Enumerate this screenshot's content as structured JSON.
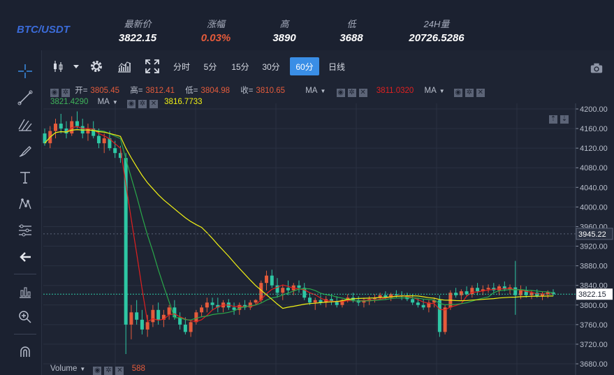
{
  "ticker": {
    "pair": "BTC/USDT",
    "stats": [
      {
        "label": "最新价",
        "value": "3822.15",
        "tone": "normal"
      },
      {
        "label": "涨幅",
        "value": "0.03%",
        "tone": "up"
      },
      {
        "label": "高",
        "value": "3890",
        "tone": "normal"
      },
      {
        "label": "低",
        "value": "3688",
        "tone": "normal"
      },
      {
        "label": "24H量",
        "value": "20726.5286",
        "tone": "normal"
      }
    ]
  },
  "toolbar": {
    "intervals": [
      "分时",
      "5分",
      "15分",
      "30分",
      "60分",
      "日线"
    ],
    "active_interval": "60分"
  },
  "left_tools": [
    "crosshair-icon",
    "trend-line-icon",
    "fib-icon",
    "brush-icon",
    "text-icon",
    "pattern-icon",
    "measure-icon",
    "back-arrow-icon",
    "indicator-icon",
    "zoom-icon",
    "magnet-icon"
  ],
  "legend": {
    "ohlc": {
      "open_label": "开=",
      "open": "3805.45",
      "high_label": "高=",
      "high": "3812.41",
      "low_label": "低=",
      "low": "3804.98",
      "close_label": "收=",
      "close": "3810.65"
    },
    "ma_label": "MA",
    "ma_red_value": "3811.0320",
    "ma_label_2": "MA",
    "ma_green_value": "3821.4290",
    "ma_label_3": "MA",
    "ma_yellow_value": "3816.7733",
    "volume_label": "Volume",
    "volume_value": "588"
  },
  "colors": {
    "up": "#e55b3b",
    "down": "#2ec7a4",
    "ma_red": "#e02020",
    "ma_green": "#2aa84a",
    "ma_yellow": "#f2f214",
    "bg": "#1e2433",
    "grid": "#2a3142",
    "last_price": "#2ec7a4"
  },
  "chart_data": {
    "type": "candlestick",
    "y_ticks": [
      4200,
      4160,
      4120,
      4080,
      4040,
      4000,
      3960,
      3920,
      3880,
      3840,
      3800,
      3760,
      3720,
      3680
    ],
    "y_tick_labels": [
      "4200.00",
      "4160.00",
      "4120.00",
      "4080.00",
      "4040.00",
      "4000.00",
      "3960.00",
      "3920.00",
      "3880.00",
      "3840.00",
      "3800.00",
      "3760.00",
      "3720.00",
      "3680.00"
    ],
    "ylim": [
      3670,
      4215
    ],
    "last_price": "3822.15",
    "crosshair_price": "3945.22",
    "candles": [
      [
        4150,
        4160,
        4125,
        4130
      ],
      [
        4130,
        4165,
        4120,
        4155
      ],
      [
        4155,
        4180,
        4140,
        4170
      ],
      [
        4170,
        4190,
        4150,
        4160
      ],
      [
        4160,
        4175,
        4140,
        4150
      ],
      [
        4150,
        4185,
        4145,
        4175
      ],
      [
        4175,
        4195,
        4160,
        4165
      ],
      [
        4165,
        4180,
        4140,
        4150
      ],
      [
        4150,
        4170,
        4135,
        4160
      ],
      [
        4160,
        4175,
        4140,
        4145
      ],
      [
        4145,
        4160,
        4120,
        4130
      ],
      [
        4130,
        4150,
        4110,
        4140
      ],
      [
        4140,
        4155,
        4115,
        4120
      ],
      [
        4120,
        4135,
        4100,
        4110
      ],
      [
        4110,
        4125,
        4090,
        4100
      ],
      [
        4100,
        4110,
        3700,
        3760
      ],
      [
        3760,
        3800,
        3730,
        3785
      ],
      [
        3785,
        3810,
        3760,
        3770
      ],
      [
        3770,
        3790,
        3740,
        3750
      ],
      [
        3750,
        3780,
        3735,
        3765
      ],
      [
        3765,
        3800,
        3755,
        3790
      ],
      [
        3790,
        3805,
        3760,
        3770
      ],
      [
        3770,
        3790,
        3755,
        3780
      ],
      [
        3780,
        3800,
        3770,
        3795
      ],
      [
        3795,
        3810,
        3770,
        3775
      ],
      [
        3775,
        3785,
        3750,
        3760
      ],
      [
        3760,
        3775,
        3740,
        3745
      ],
      [
        3745,
        3770,
        3735,
        3765
      ],
      [
        3765,
        3790,
        3760,
        3785
      ],
      [
        3785,
        3800,
        3775,
        3795
      ],
      [
        3795,
        3815,
        3785,
        3805
      ],
      [
        3805,
        3815,
        3790,
        3800
      ],
      [
        3800,
        3815,
        3785,
        3795
      ],
      [
        3795,
        3810,
        3785,
        3805
      ],
      [
        3805,
        3812,
        3790,
        3795
      ],
      [
        3795,
        3805,
        3780,
        3790
      ],
      [
        3790,
        3805,
        3780,
        3800
      ],
      [
        3800,
        3810,
        3790,
        3795
      ],
      [
        3795,
        3810,
        3790,
        3805
      ],
      [
        3805,
        3812,
        3800,
        3810
      ],
      [
        3810,
        3850,
        3805,
        3845
      ],
      [
        3845,
        3870,
        3830,
        3860
      ],
      [
        3860,
        3872,
        3835,
        3840
      ],
      [
        3840,
        3855,
        3815,
        3825
      ],
      [
        3825,
        3840,
        3810,
        3835
      ],
      [
        3835,
        3850,
        3820,
        3830
      ],
      [
        3830,
        3845,
        3820,
        3840
      ],
      [
        3840,
        3850,
        3825,
        3835
      ],
      [
        3835,
        3845,
        3810,
        3815
      ],
      [
        3815,
        3825,
        3800,
        3805
      ],
      [
        3805,
        3815,
        3790,
        3810
      ],
      [
        3810,
        3820,
        3800,
        3805
      ],
      [
        3805,
        3818,
        3795,
        3812
      ],
      [
        3812,
        3822,
        3800,
        3808
      ],
      [
        3808,
        3818,
        3795,
        3800
      ],
      [
        3800,
        3812,
        3795,
        3810
      ],
      [
        3810,
        3822,
        3805,
        3815
      ],
      [
        3815,
        3825,
        3805,
        3810
      ],
      [
        3810,
        3818,
        3798,
        3805
      ],
      [
        3805,
        3815,
        3795,
        3808
      ],
      [
        3808,
        3818,
        3800,
        3812
      ],
      [
        3812,
        3822,
        3805,
        3815
      ],
      [
        3815,
        3825,
        3810,
        3820
      ],
      [
        3820,
        3828,
        3812,
        3815
      ],
      [
        3815,
        3825,
        3808,
        3822
      ],
      [
        3822,
        3830,
        3815,
        3820
      ],
      [
        3820,
        3828,
        3810,
        3818
      ],
      [
        3818,
        3825,
        3808,
        3812
      ],
      [
        3812,
        3822,
        3800,
        3805
      ],
      [
        3805,
        3815,
        3795,
        3800
      ],
      [
        3800,
        3812,
        3790,
        3795
      ],
      [
        3795,
        3810,
        3785,
        3805
      ],
      [
        3805,
        3815,
        3795,
        3810
      ],
      [
        3810,
        3820,
        3735,
        3745
      ],
      [
        3745,
        3800,
        3740,
        3795
      ],
      [
        3795,
        3830,
        3790,
        3825
      ],
      [
        3825,
        3835,
        3815,
        3820
      ],
      [
        3820,
        3832,
        3810,
        3828
      ],
      [
        3828,
        3838,
        3818,
        3822
      ],
      [
        3822,
        3840,
        3815,
        3835
      ],
      [
        3835,
        3845,
        3820,
        3828
      ],
      [
        3828,
        3840,
        3820,
        3832
      ],
      [
        3832,
        3842,
        3825,
        3835
      ],
      [
        3835,
        3845,
        3825,
        3830
      ],
      [
        3830,
        3842,
        3820,
        3838
      ],
      [
        3838,
        3848,
        3828,
        3832
      ],
      [
        3832,
        3842,
        3822,
        3836
      ],
      [
        3836,
        3890,
        3780,
        3820
      ],
      [
        3820,
        3840,
        3812,
        3830
      ],
      [
        3830,
        3838,
        3815,
        3820
      ],
      [
        3820,
        3830,
        3812,
        3825
      ],
      [
        3825,
        3832,
        3815,
        3818
      ],
      [
        3818,
        3828,
        3810,
        3822
      ],
      [
        3822,
        3830,
        3814,
        3826
      ],
      [
        3826,
        3832,
        3818,
        3822
      ]
    ],
    "ma_series": [
      {
        "color_key": "ma_red"
      },
      {
        "color_key": "ma_green"
      },
      {
        "color_key": "ma_yellow"
      }
    ]
  }
}
